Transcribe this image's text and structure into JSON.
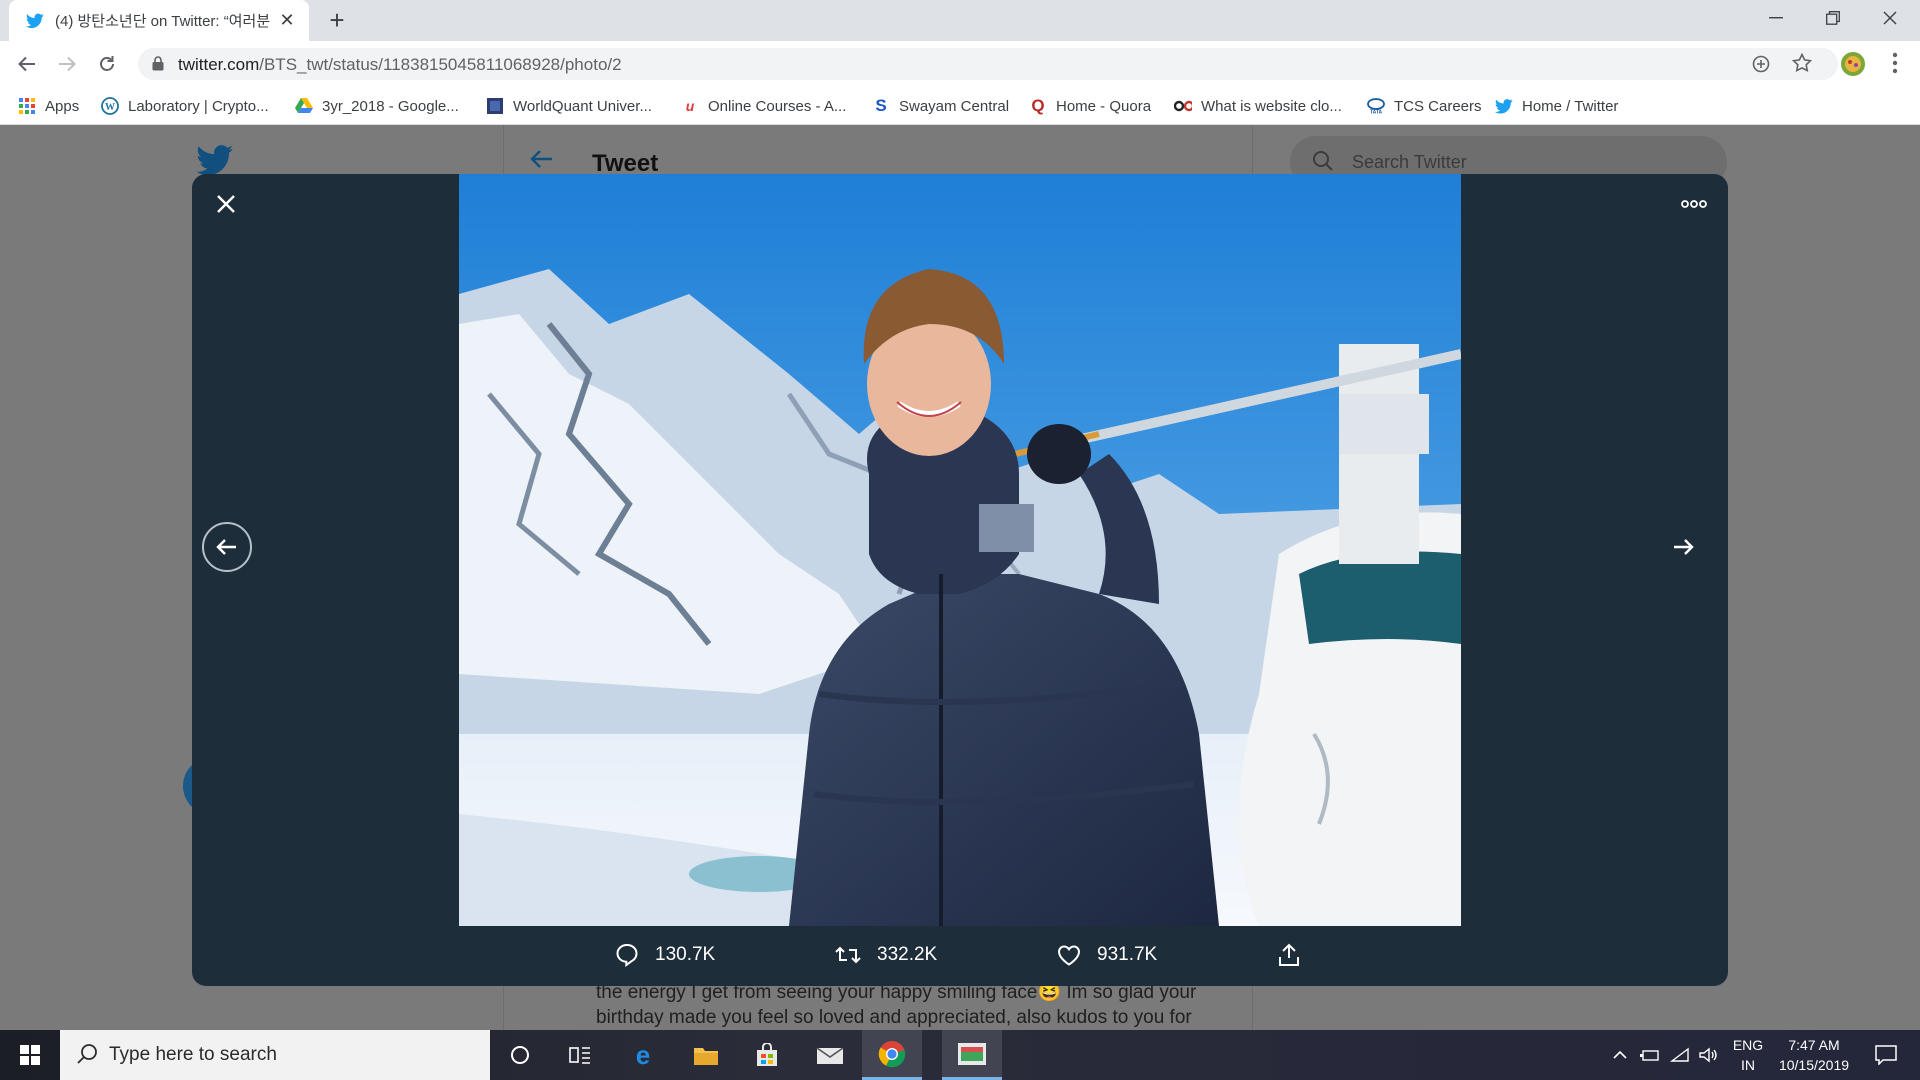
{
  "browser": {
    "tab_title": "(4) 방탄소년단 on Twitter: “여러분",
    "url_domain": "twitter.com",
    "url_path": "/BTS_twt/status/1183815045811068928/photo/2",
    "bookmarks": [
      {
        "label": "Apps",
        "icon": "apps-grid-icon",
        "color": "#4285f4"
      },
      {
        "label": "Laboratory | Crypto...",
        "icon": "wordpress-icon",
        "color": "#21759b"
      },
      {
        "label": "3yr_2018 - Google...",
        "icon": "google-drive-icon",
        "color": "#fbbc04"
      },
      {
        "label": "WorldQuant Univer...",
        "icon": "worldquant-icon",
        "color": "#2c3e70"
      },
      {
        "label": "Online Courses - A...",
        "icon": "udemy-icon",
        "color": "#e03a3a"
      },
      {
        "label": "Swayam Central",
        "icon": "swayam-icon",
        "color": "#1a56c4"
      },
      {
        "label": "Home - Quora",
        "icon": "quora-icon",
        "color": "#b92b27"
      },
      {
        "label": "What is website clo...",
        "icon": "link-icon",
        "color": "#333333"
      },
      {
        "label": "TCS Careers",
        "icon": "tata-icon",
        "color": "#1a5aa6"
      },
      {
        "label": "Home / Twitter",
        "icon": "twitter-bird-icon",
        "color": "#1da1f2"
      }
    ]
  },
  "page": {
    "heading": "Tweet",
    "search_placeholder": "Search Twitter",
    "tweet_text": "the energy I get from seeing your happy smiling face😆 Im so glad your birthday made you feel so loved and appreciated, also kudos to you for"
  },
  "modal": {
    "replies": "130.7K",
    "retweets": "332.2K",
    "likes": "931.7K"
  },
  "taskbar": {
    "search_placeholder": "Type here to search",
    "lang_top": "ENG",
    "lang_bottom": "IN",
    "time": "7:47 AM",
    "date": "10/15/2019"
  },
  "colors": {
    "twitter_blue": "#1da1f2",
    "modal_bg": "#1e2d3a"
  }
}
